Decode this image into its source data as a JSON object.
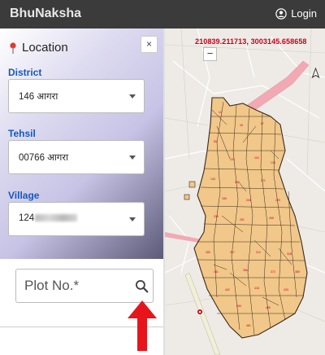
{
  "app": {
    "brand": "BhuNaksha",
    "login_label": "Login"
  },
  "panel": {
    "title": "Location",
    "close_label": "×",
    "district": {
      "label": "District",
      "value": "146 आगरा"
    },
    "tehsil": {
      "label": "Tehsil",
      "value": "00766 आगरा"
    },
    "village": {
      "label": "Village",
      "value": "124"
    }
  },
  "plot_search": {
    "placeholder": "Plot No.*"
  },
  "map": {
    "coordinates": "210839.211713, 3003145.658658",
    "zoom_out_label": "−"
  },
  "colors": {
    "header_bg": "#3b3b3b",
    "label_blue": "#1557c0",
    "coord_red": "#c8001a",
    "parcel_fill": "#f1c78a",
    "road_pink": "#f2a9b4",
    "arrow_red": "#e8141c"
  }
}
